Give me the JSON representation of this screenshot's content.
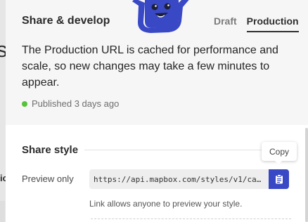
{
  "background": {
    "heading_fragment": "s",
    "label_fragment": "ic"
  },
  "panel": {
    "title": "Share & develop",
    "tabs": [
      {
        "label": "Draft",
        "active": false
      },
      {
        "label": "Production",
        "active": true
      }
    ],
    "description": "The Production URL is cached for performance and scale, so new changes may take a few minutes to appear.",
    "status": {
      "text": "Published 3 days ago",
      "color": "#58c23b"
    }
  },
  "share_style": {
    "title": "Share style",
    "preview": {
      "label": "Preview only",
      "url": "https://api.mapbox.com/styles/v1/caro…",
      "copy_icon": "clipboard-icon",
      "tooltip": "Copy",
      "hint": "Link allows anyone to preview your style."
    }
  },
  "colors": {
    "accent": "#3949c5",
    "mascot": "#3949c5"
  }
}
